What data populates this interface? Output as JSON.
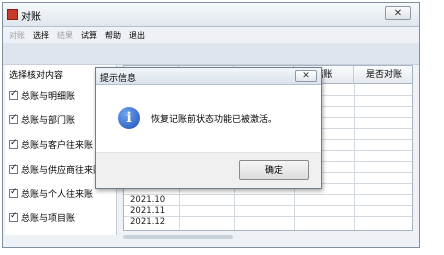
{
  "window": {
    "title": "对账",
    "close_glyph": "✕"
  },
  "menu": [
    {
      "label": "对账",
      "disabled": true
    },
    {
      "label": "选择",
      "disabled": false
    },
    {
      "label": "结果",
      "disabled": true
    },
    {
      "label": "试算",
      "disabled": false
    },
    {
      "label": "帮助",
      "disabled": false
    },
    {
      "label": "退出",
      "disabled": false
    }
  ],
  "left_panel": {
    "header": "选择核对内容",
    "items": [
      "总账与明细账",
      "总账与部门账",
      "总账与客户往来账",
      "总账与供应商往来账",
      "总账与个人往来账",
      "总账与项目账"
    ]
  },
  "table": {
    "columns": [
      "结账",
      "是否对账"
    ],
    "periods": [
      "2021.10",
      "2021.11",
      "2021.12"
    ]
  },
  "dialog": {
    "title": "提示信息",
    "message": "恢复记账前状态功能已被激活。",
    "ok_label": "确定",
    "close_glyph": "✕"
  }
}
